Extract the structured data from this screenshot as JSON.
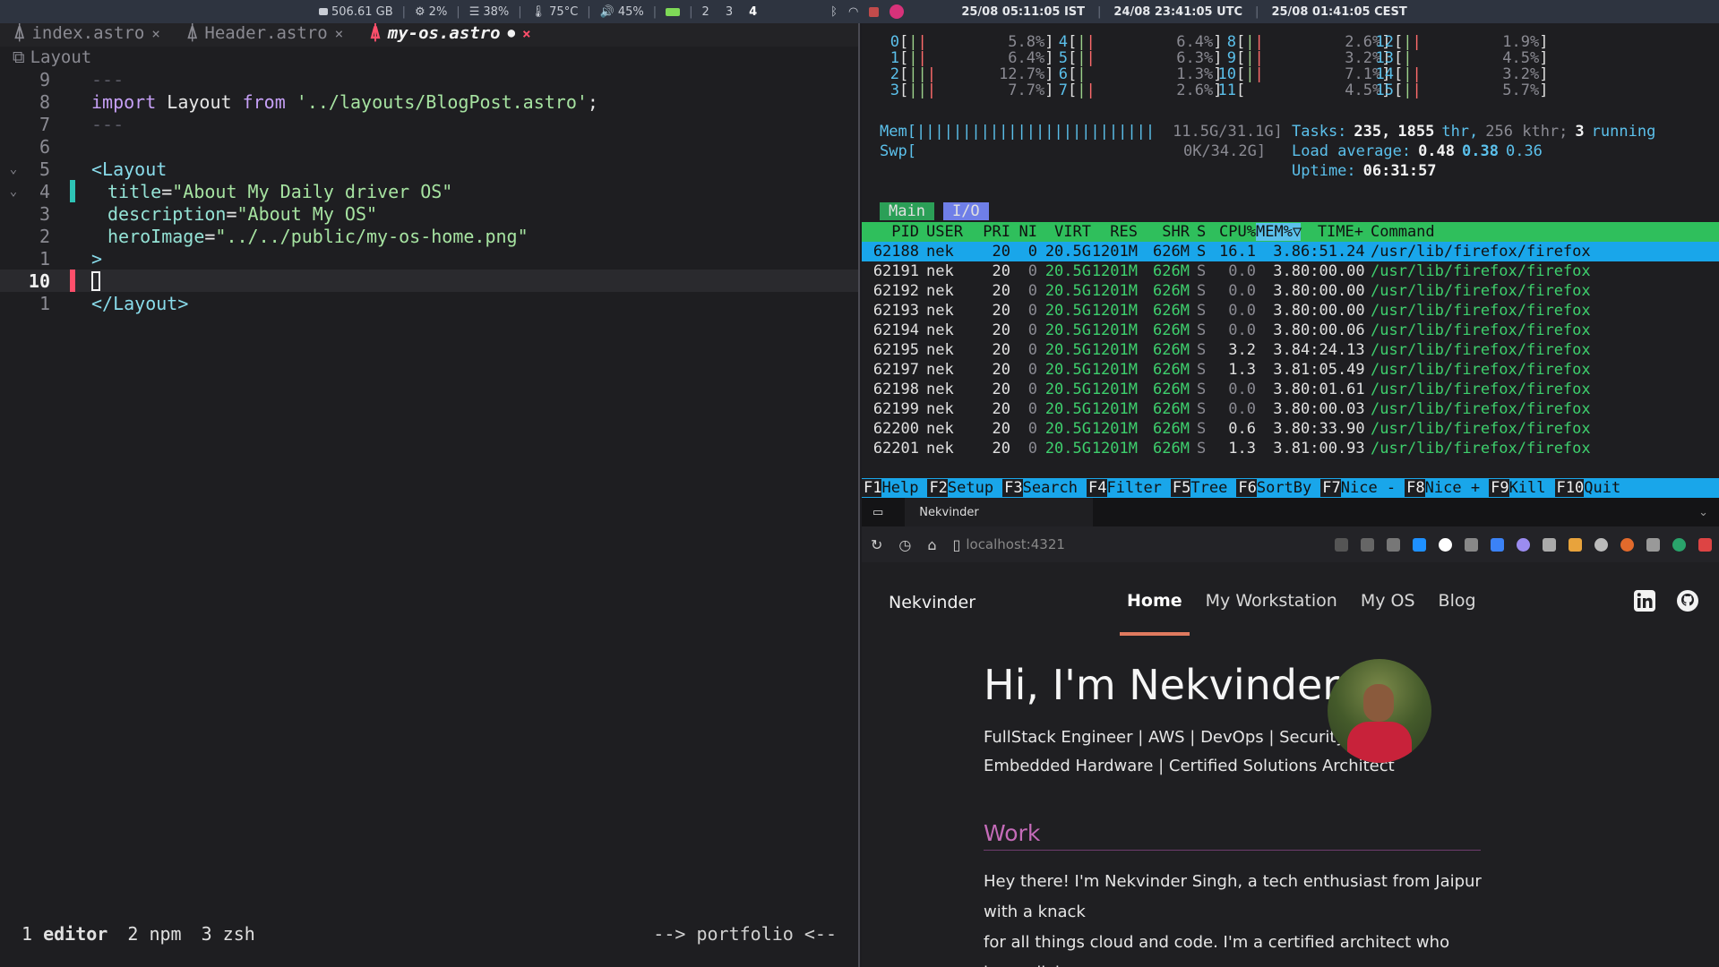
{
  "statusbar": {
    "disk": "506.61 GB",
    "cpu": "2%",
    "mem": "38%",
    "temp": "75°C",
    "volume": "45%",
    "workspaces": [
      "2",
      "3",
      "4"
    ],
    "clock_ist": "25/08 05:11:05 IST",
    "clock_utc": "24/08 23:41:05 UTC",
    "clock_cest": "25/08 01:41:05 CEST"
  },
  "editor": {
    "tabs": [
      {
        "name": "index.astro",
        "close": "×"
      },
      {
        "name": "Header.astro",
        "close": "×"
      },
      {
        "name": "my-os.astro",
        "modified": "●",
        "close": "×"
      }
    ],
    "breadcrumb": "Layout",
    "lines": [
      {
        "num": "9",
        "text": "---"
      },
      {
        "num": "8",
        "kw": "import",
        "ident": " Layout ",
        "kw2": "from",
        "str": " '../layouts/BlogPost.astro'",
        "end": ";"
      },
      {
        "num": "7",
        "text": "---"
      },
      {
        "num": "6"
      },
      {
        "num": "5",
        "tag": "<Layout"
      },
      {
        "num": "4",
        "attr": "title",
        "eq": "=",
        "str": "\"About My Daily driver OS\""
      },
      {
        "num": "3",
        "attr": "description",
        "eq": "=",
        "str": "\"About My OS\""
      },
      {
        "num": "2",
        "attr": "heroImage",
        "eq": "=",
        "str": "\"../../public/my-os-home.png\""
      },
      {
        "num": "1",
        "tag": ">"
      },
      {
        "num": "10"
      },
      {
        "num": "1",
        "tag": "</Layout>"
      }
    ],
    "tmux": {
      "windows": [
        {
          "index": "1",
          "name": "editor"
        },
        {
          "index": "2",
          "name": "npm"
        },
        {
          "index": "3",
          "name": "zsh"
        }
      ],
      "project": "--> portfolio <--"
    }
  },
  "htop": {
    "cpus": [
      {
        "id": "0",
        "pct": "5.8%"
      },
      {
        "id": "1",
        "pct": "6.4%"
      },
      {
        "id": "2",
        "pct": "12.7%"
      },
      {
        "id": "3",
        "pct": "7.7%"
      },
      {
        "id": "4",
        "pct": "6.4%"
      },
      {
        "id": "5",
        "pct": "6.3%"
      },
      {
        "id": "6",
        "pct": "1.3%"
      },
      {
        "id": "7",
        "pct": "2.6%"
      },
      {
        "id": "8",
        "pct": "2.6%"
      },
      {
        "id": "9",
        "pct": "3.2%"
      },
      {
        "id": "10",
        "pct": "7.1%"
      },
      {
        "id": "11",
        "pct": "4.5%"
      },
      {
        "id": "12",
        "pct": "1.9%"
      },
      {
        "id": "13",
        "pct": "4.5%"
      },
      {
        "id": "14",
        "pct": "3.2%"
      },
      {
        "id": "15",
        "pct": "5.7%"
      }
    ],
    "mem_label": "Mem[",
    "mem_value": "11.5G/31.1G]",
    "swp_label": "Swp[",
    "swp_value": "0K/34.2G]",
    "tasks_label": "Tasks:",
    "tasks": "235,",
    "threads": "1855",
    "thr_label": "thr,",
    "kthr": "256 kthr;",
    "running": "3",
    "running_label": "running",
    "load_label": "Load average:",
    "load1": "0.48",
    "load5": "0.38",
    "load15": "0.36",
    "uptime_label": "Uptime:",
    "uptime": "06:31:57",
    "tabs": [
      "Main",
      "I/O"
    ],
    "columns": [
      "PID",
      "USER",
      "PRI",
      "NI",
      "VIRT",
      "RES",
      "SHR",
      "S",
      "CPU%",
      "MEM%▽",
      "TIME+",
      "Command"
    ],
    "processes": [
      {
        "pid": "62188",
        "user": "nek",
        "pri": "20",
        "ni": "0",
        "virt": "20.5G",
        "res": "1201M",
        "shr": "626M",
        "s": "S",
        "cpu": "16.1",
        "mem": "3.8",
        "time": "6:51.24",
        "cmd": "/usr/lib/firefox/firefox"
      },
      {
        "pid": "62191",
        "user": "nek",
        "pri": "20",
        "ni": "0",
        "virt": "20.5G",
        "res": "1201M",
        "shr": "626M",
        "s": "S",
        "cpu": "0.0",
        "mem": "3.8",
        "time": "0:00.00",
        "cmd": "/usr/lib/firefox/firefox"
      },
      {
        "pid": "62192",
        "user": "nek",
        "pri": "20",
        "ni": "0",
        "virt": "20.5G",
        "res": "1201M",
        "shr": "626M",
        "s": "S",
        "cpu": "0.0",
        "mem": "3.8",
        "time": "0:00.00",
        "cmd": "/usr/lib/firefox/firefox"
      },
      {
        "pid": "62193",
        "user": "nek",
        "pri": "20",
        "ni": "0",
        "virt": "20.5G",
        "res": "1201M",
        "shr": "626M",
        "s": "S",
        "cpu": "0.0",
        "mem": "3.8",
        "time": "0:00.00",
        "cmd": "/usr/lib/firefox/firefox"
      },
      {
        "pid": "62194",
        "user": "nek",
        "pri": "20",
        "ni": "0",
        "virt": "20.5G",
        "res": "1201M",
        "shr": "626M",
        "s": "S",
        "cpu": "0.0",
        "mem": "3.8",
        "time": "0:00.06",
        "cmd": "/usr/lib/firefox/firefox"
      },
      {
        "pid": "62195",
        "user": "nek",
        "pri": "20",
        "ni": "0",
        "virt": "20.5G",
        "res": "1201M",
        "shr": "626M",
        "s": "S",
        "cpu": "3.2",
        "mem": "3.8",
        "time": "4:24.13",
        "cmd": "/usr/lib/firefox/firefox"
      },
      {
        "pid": "62197",
        "user": "nek",
        "pri": "20",
        "ni": "0",
        "virt": "20.5G",
        "res": "1201M",
        "shr": "626M",
        "s": "S",
        "cpu": "1.3",
        "mem": "3.8",
        "time": "1:05.49",
        "cmd": "/usr/lib/firefox/firefox"
      },
      {
        "pid": "62198",
        "user": "nek",
        "pri": "20",
        "ni": "0",
        "virt": "20.5G",
        "res": "1201M",
        "shr": "626M",
        "s": "S",
        "cpu": "0.0",
        "mem": "3.8",
        "time": "0:01.61",
        "cmd": "/usr/lib/firefox/firefox"
      },
      {
        "pid": "62199",
        "user": "nek",
        "pri": "20",
        "ni": "0",
        "virt": "20.5G",
        "res": "1201M",
        "shr": "626M",
        "s": "S",
        "cpu": "0.0",
        "mem": "3.8",
        "time": "0:00.03",
        "cmd": "/usr/lib/firefox/firefox"
      },
      {
        "pid": "62200",
        "user": "nek",
        "pri": "20",
        "ni": "0",
        "virt": "20.5G",
        "res": "1201M",
        "shr": "626M",
        "s": "S",
        "cpu": "0.6",
        "mem": "3.8",
        "time": "0:33.90",
        "cmd": "/usr/lib/firefox/firefox"
      },
      {
        "pid": "62201",
        "user": "nek",
        "pri": "20",
        "ni": "0",
        "virt": "20.5G",
        "res": "1201M",
        "shr": "626M",
        "s": "S",
        "cpu": "1.3",
        "mem": "3.8",
        "time": "1:00.93",
        "cmd": "/usr/lib/firefox/firefox"
      }
    ],
    "fkeys": [
      {
        "key": "F1",
        "label": "Help"
      },
      {
        "key": "F2",
        "label": "Setup"
      },
      {
        "key": "F3",
        "label": "Search"
      },
      {
        "key": "F4",
        "label": "Filter"
      },
      {
        "key": "F5",
        "label": "Tree"
      },
      {
        "key": "F6",
        "label": "SortBy"
      },
      {
        "key": "F7",
        "label": "Nice -"
      },
      {
        "key": "F8",
        "label": "Nice +"
      },
      {
        "key": "F9",
        "label": "Kill"
      },
      {
        "key": "F10",
        "label": "Quit"
      }
    ]
  },
  "browser": {
    "tab_title": "Nekvinder",
    "url": "localhost:4321",
    "site": {
      "brand": "Nekvinder",
      "nav": [
        "Home",
        "My Workstation",
        "My OS",
        "Blog"
      ],
      "hero_title": "Hi, I'm Nekvinder",
      "hero_line1": "FullStack Engineer | AWS | DevOps | Security",
      "hero_line2": "Embedded Hardware | Certified Solutions Architect",
      "section_title": "Work",
      "intro_line1": "Hey there! I'm Nekvinder Singh, a tech enthusiast from Jaipur with a knack",
      "intro_line2": "for all things cloud and code. I'm a certified architect who loves diving"
    }
  },
  "colors": {
    "accent_underline": "#e07a5f",
    "section_title": "#c46bb8",
    "htop_header": "#2fbf5c",
    "htop_selected": "#19a6ea"
  }
}
